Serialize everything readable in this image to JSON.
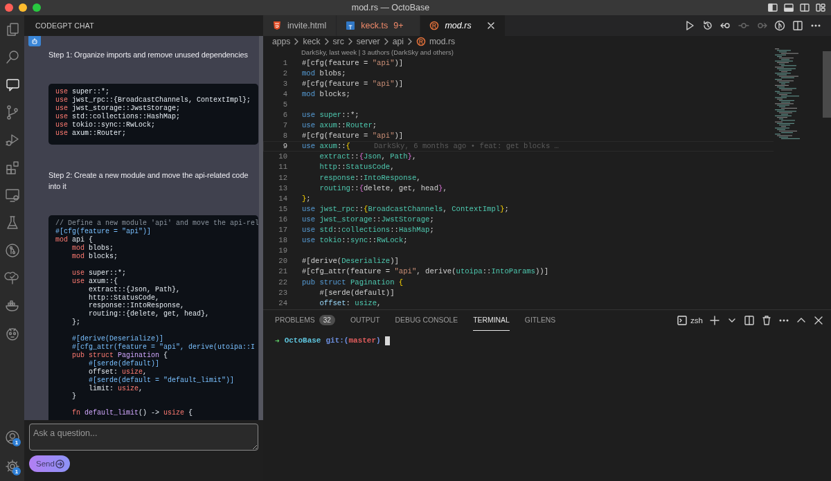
{
  "window": {
    "title": "mod.rs — OctoBase"
  },
  "activity_bar": {
    "items": [
      {
        "kind": "files",
        "selected": false
      },
      {
        "kind": "search",
        "selected": false
      },
      {
        "kind": "chat",
        "selected": true
      },
      {
        "kind": "branch",
        "selected": false
      },
      {
        "kind": "debug",
        "selected": false
      },
      {
        "kind": "blocks",
        "selected": false
      },
      {
        "kind": "monitor",
        "selected": false
      },
      {
        "kind": "flask",
        "selected": false
      },
      {
        "kind": "gitlens",
        "selected": false
      },
      {
        "kind": "tree",
        "selected": false
      },
      {
        "kind": "whale",
        "selected": false
      },
      {
        "kind": "robot",
        "selected": false
      }
    ],
    "bottom": [
      {
        "kind": "account",
        "badge": "1"
      },
      {
        "kind": "settings",
        "badge": "1"
      }
    ]
  },
  "chat": {
    "title": "CODEGPT CHAT",
    "messages": [
      {
        "kind": "text",
        "text": "Step 1: Organize imports and remove unused dependencies"
      },
      {
        "kind": "code",
        "lines": [
          {
            "segments": [
              {
                "kind": "kw",
                "text": "use"
              },
              {
                "kind": "p",
                "text": " super::*;"
              }
            ]
          },
          {
            "segments": [
              {
                "kind": "kw",
                "text": "use"
              },
              {
                "kind": "p",
                "text": " jwst_rpc::{BroadcastChannels, ContextImpl};"
              }
            ]
          },
          {
            "segments": [
              {
                "kind": "kw",
                "text": "use"
              },
              {
                "kind": "p",
                "text": " jwst_storage::JwstStorage;"
              }
            ]
          },
          {
            "segments": [
              {
                "kind": "kw",
                "text": "use"
              },
              {
                "kind": "p",
                "text": " std::collections::HashMap;"
              }
            ]
          },
          {
            "segments": [
              {
                "kind": "kw",
                "text": "use"
              },
              {
                "kind": "p",
                "text": " tokio::sync::RwLock;"
              }
            ]
          },
          {
            "segments": [
              {
                "kind": "kw",
                "text": "use"
              },
              {
                "kind": "p",
                "text": " axum::Router;"
              }
            ]
          }
        ]
      },
      {
        "kind": "text",
        "text": "Step 2: Create a new module and move the api-related code into it"
      },
      {
        "kind": "code",
        "lines": [
          {
            "segments": [
              {
                "kind": "cm",
                "text": "// Define a new module 'api' and move the api-rel"
              }
            ]
          },
          {
            "segments": [
              {
                "kind": "attr",
                "text": "#[cfg(feature = \"api\")]"
              }
            ]
          },
          {
            "segments": [
              {
                "kind": "kw",
                "text": "mod"
              },
              {
                "kind": "p",
                "text": " api {"
              }
            ]
          },
          {
            "segments": [
              {
                "kind": "kw",
                "text": "    mod"
              },
              {
                "kind": "p",
                "text": " blobs;"
              }
            ]
          },
          {
            "segments": [
              {
                "kind": "kw",
                "text": "    mod"
              },
              {
                "kind": "p",
                "text": " blocks;"
              }
            ]
          },
          {
            "gap_before": true,
            "segments": [
              {
                "kind": "kw",
                "text": "    use"
              },
              {
                "kind": "p",
                "text": " super::*;"
              }
            ]
          },
          {
            "segments": [
              {
                "kind": "kw",
                "text": "    use"
              },
              {
                "kind": "p",
                "text": " axum::{"
              }
            ]
          },
          {
            "segments": [
              {
                "kind": "p",
                "text": "        extract::{Json, Path},"
              }
            ]
          },
          {
            "segments": [
              {
                "kind": "p",
                "text": "        http::StatusCode,"
              }
            ]
          },
          {
            "segments": [
              {
                "kind": "p",
                "text": "        response::IntoResponse,"
              }
            ]
          },
          {
            "segments": [
              {
                "kind": "p",
                "text": "        routing::{delete, get, head},"
              }
            ]
          },
          {
            "segments": [
              {
                "kind": "p",
                "text": "    };"
              }
            ]
          },
          {
            "gap_before": true,
            "segments": [
              {
                "kind": "attr",
                "text": "    #[derive(Deserialize)]"
              }
            ]
          },
          {
            "segments": [
              {
                "kind": "attr",
                "text": "    #[cfg_attr(feature = \"api\", derive(utoipa::I"
              }
            ]
          },
          {
            "segments": [
              {
                "kind": "kw",
                "text": "    pub struct "
              },
              {
                "kind": "ty",
                "text": "Pagination"
              },
              {
                "kind": "p",
                "text": " {"
              }
            ]
          },
          {
            "segments": [
              {
                "kind": "attr",
                "text": "        #[serde(default)]"
              }
            ]
          },
          {
            "segments": [
              {
                "kind": "p",
                "text": "        offset: "
              },
              {
                "kind": "kw",
                "text": "usize"
              },
              {
                "kind": "p",
                "text": ","
              }
            ]
          },
          {
            "segments": [
              {
                "kind": "attr",
                "text": "        #[serde(default = \"default_limit\")]"
              }
            ]
          },
          {
            "segments": [
              {
                "kind": "p",
                "text": "        limit: "
              },
              {
                "kind": "kw",
                "text": "usize"
              },
              {
                "kind": "p",
                "text": ","
              }
            ]
          },
          {
            "segments": [
              {
                "kind": "p",
                "text": "    }"
              }
            ]
          },
          {
            "gap_before": true,
            "segments": [
              {
                "kind": "kw",
                "text": "    fn "
              },
              {
                "kind": "ty",
                "text": "default_limit"
              },
              {
                "kind": "p",
                "text": "() -> "
              },
              {
                "kind": "kw",
                "text": "usize"
              },
              {
                "kind": "p",
                "text": " {"
              }
            ]
          }
        ]
      }
    ],
    "input": {
      "placeholder": "Ask a question..."
    },
    "send_button": "Send"
  },
  "editor": {
    "tabs": [
      {
        "label": "invite.html",
        "kind": "html",
        "selected": false
      },
      {
        "label": "keck.ts",
        "kind": "ts",
        "badge": "9+",
        "selected": false
      },
      {
        "label": "mod.rs",
        "kind": "rust",
        "selected": true
      }
    ],
    "breadcrumb": [
      "apps",
      "keck",
      "src",
      "server",
      "api",
      "mod.rs"
    ],
    "blame_header": "DarkSky, last week | 3 authors (DarkSky and others)",
    "lines": [
      {
        "number": "1",
        "current": false,
        "segments": [
          {
            "kind": "p",
            "text": "#[cfg(feature = "
          },
          {
            "kind": "str",
            "text": "\"api\""
          },
          {
            "kind": "p",
            "text": ")]"
          }
        ]
      },
      {
        "number": "2",
        "current": false,
        "segments": [
          {
            "kind": "kw",
            "text": "mod"
          },
          {
            "kind": "p",
            "text": " blobs;"
          }
        ]
      },
      {
        "number": "3",
        "current": false,
        "segments": [
          {
            "kind": "p",
            "text": "#[cfg(feature = "
          },
          {
            "kind": "str",
            "text": "\"api\""
          },
          {
            "kind": "p",
            "text": ")]"
          }
        ]
      },
      {
        "number": "4",
        "current": false,
        "segments": [
          {
            "kind": "kw",
            "text": "mod"
          },
          {
            "kind": "p",
            "text": " blocks;"
          }
        ]
      },
      {
        "number": "5",
        "current": false
      },
      {
        "number": "6",
        "current": false,
        "segments": [
          {
            "kind": "kw",
            "text": "use "
          },
          {
            "kind": "ns",
            "text": "super"
          },
          {
            "kind": "p",
            "text": "::*;"
          }
        ]
      },
      {
        "number": "7",
        "current": false,
        "segments": [
          {
            "kind": "kw",
            "text": "use "
          },
          {
            "kind": "ns",
            "text": "axum"
          },
          {
            "kind": "p",
            "text": "::"
          },
          {
            "kind": "ns",
            "text": "Router"
          },
          {
            "kind": "p",
            "text": ";"
          }
        ]
      },
      {
        "number": "8",
        "current": false,
        "segments": [
          {
            "kind": "p",
            "text": "#[cfg(feature = "
          },
          {
            "kind": "str",
            "text": "\"api\""
          },
          {
            "kind": "p",
            "text": ")]"
          }
        ]
      },
      {
        "number": "9",
        "current": true,
        "segments": [
          {
            "kind": "kw",
            "text": "use "
          },
          {
            "kind": "ns",
            "text": "axum"
          },
          {
            "kind": "p",
            "text": "::"
          },
          {
            "kind": "br",
            "text": "{"
          }
        ],
        "blame": "DarkSky, 6 months ago • feat: get blocks …"
      },
      {
        "number": "10",
        "current": false,
        "segments": [
          {
            "kind": "ns",
            "text": "    extract"
          },
          {
            "kind": "p",
            "text": "::"
          },
          {
            "kind": "br2",
            "text": "{"
          },
          {
            "kind": "ns",
            "text": "Json"
          },
          {
            "kind": "p",
            "text": ", "
          },
          {
            "kind": "ns",
            "text": "Path"
          },
          {
            "kind": "br2",
            "text": "}"
          },
          {
            "kind": "p",
            "text": ","
          }
        ]
      },
      {
        "number": "11",
        "current": false,
        "segments": [
          {
            "kind": "ns",
            "text": "    http"
          },
          {
            "kind": "p",
            "text": "::"
          },
          {
            "kind": "ns",
            "text": "StatusCode"
          },
          {
            "kind": "p",
            "text": ","
          }
        ]
      },
      {
        "number": "12",
        "current": false,
        "segments": [
          {
            "kind": "ns",
            "text": "    response"
          },
          {
            "kind": "p",
            "text": "::"
          },
          {
            "kind": "ns",
            "text": "IntoResponse"
          },
          {
            "kind": "p",
            "text": ","
          }
        ]
      },
      {
        "number": "13",
        "current": false,
        "segments": [
          {
            "kind": "ns",
            "text": "    routing"
          },
          {
            "kind": "p",
            "text": "::"
          },
          {
            "kind": "br2",
            "text": "{"
          },
          {
            "kind": "p",
            "text": "delete, get, head"
          },
          {
            "kind": "br2",
            "text": "}"
          },
          {
            "kind": "p",
            "text": ","
          }
        ]
      },
      {
        "number": "14",
        "current": false,
        "segments": [
          {
            "kind": "br",
            "text": "}"
          },
          {
            "kind": "p",
            "text": ";"
          }
        ]
      },
      {
        "number": "15",
        "current": false,
        "segments": [
          {
            "kind": "kw",
            "text": "use "
          },
          {
            "kind": "ns",
            "text": "jwst_rpc"
          },
          {
            "kind": "p",
            "text": "::"
          },
          {
            "kind": "br",
            "text": "{"
          },
          {
            "kind": "ns",
            "text": "BroadcastChannels"
          },
          {
            "kind": "p",
            "text": ", "
          },
          {
            "kind": "ns",
            "text": "ContextImpl"
          },
          {
            "kind": "br",
            "text": "}"
          },
          {
            "kind": "p",
            "text": ";"
          }
        ]
      },
      {
        "number": "16",
        "current": false,
        "segments": [
          {
            "kind": "kw",
            "text": "use "
          },
          {
            "kind": "ns",
            "text": "jwst_storage"
          },
          {
            "kind": "p",
            "text": "::"
          },
          {
            "kind": "ns",
            "text": "JwstStorage"
          },
          {
            "kind": "p",
            "text": ";"
          }
        ]
      },
      {
        "number": "17",
        "current": false,
        "segments": [
          {
            "kind": "kw",
            "text": "use "
          },
          {
            "kind": "ns",
            "text": "std"
          },
          {
            "kind": "p",
            "text": "::"
          },
          {
            "kind": "ns",
            "text": "collections"
          },
          {
            "kind": "p",
            "text": "::"
          },
          {
            "kind": "ns",
            "text": "HashMap"
          },
          {
            "kind": "p",
            "text": ";"
          }
        ]
      },
      {
        "number": "18",
        "current": false,
        "segments": [
          {
            "kind": "kw",
            "text": "use "
          },
          {
            "kind": "ns",
            "text": "tokio"
          },
          {
            "kind": "p",
            "text": "::"
          },
          {
            "kind": "ns",
            "text": "sync"
          },
          {
            "kind": "p",
            "text": "::"
          },
          {
            "kind": "ns",
            "text": "RwLock"
          },
          {
            "kind": "p",
            "text": ";"
          }
        ]
      },
      {
        "number": "19",
        "current": false
      },
      {
        "number": "20",
        "current": false,
        "segments": [
          {
            "kind": "p",
            "text": "#[derive("
          },
          {
            "kind": "ns",
            "text": "Deserialize"
          },
          {
            "kind": "p",
            "text": ")]"
          }
        ]
      },
      {
        "number": "21",
        "current": false,
        "segments": [
          {
            "kind": "p",
            "text": "#[cfg_attr(feature = "
          },
          {
            "kind": "str",
            "text": "\"api\""
          },
          {
            "kind": "p",
            "text": ", derive("
          },
          {
            "kind": "ns",
            "text": "utoipa"
          },
          {
            "kind": "p",
            "text": "::"
          },
          {
            "kind": "ns",
            "text": "IntoParams"
          },
          {
            "kind": "p",
            "text": "))]"
          }
        ]
      },
      {
        "number": "22",
        "current": false,
        "segments": [
          {
            "kind": "kw",
            "text": "pub struct "
          },
          {
            "kind": "ns",
            "text": "Pagination"
          },
          {
            "kind": "br",
            "text": " {"
          }
        ]
      },
      {
        "number": "23",
        "current": false,
        "segments": [
          {
            "kind": "p",
            "text": "    #[serde(default)]"
          }
        ]
      },
      {
        "number": "24",
        "current": false,
        "segments": [
          {
            "kind": "var",
            "text": "    offset"
          },
          {
            "kind": "p",
            "text": ": "
          },
          {
            "kind": "ns",
            "text": "usize"
          },
          {
            "kind": "p",
            "text": ","
          }
        ]
      }
    ]
  },
  "panel": {
    "tabs": [
      {
        "label": "PROBLEMS",
        "badge": "32",
        "selected": false
      },
      {
        "label": "OUTPUT",
        "selected": false
      },
      {
        "label": "DEBUG CONSOLE",
        "selected": false
      },
      {
        "label": "TERMINAL",
        "selected": true
      },
      {
        "label": "GITLENS",
        "selected": false
      }
    ],
    "terminal_profile": "zsh",
    "prompt": [
      {
        "kind": "arrow",
        "text": "➜"
      },
      {
        "kind": "dir",
        "text": "OctoBase"
      },
      {
        "kind": "git",
        "text": "git:("
      },
      {
        "kind": "branch",
        "text": "master"
      },
      {
        "kind": "git",
        "text": ")"
      }
    ]
  }
}
